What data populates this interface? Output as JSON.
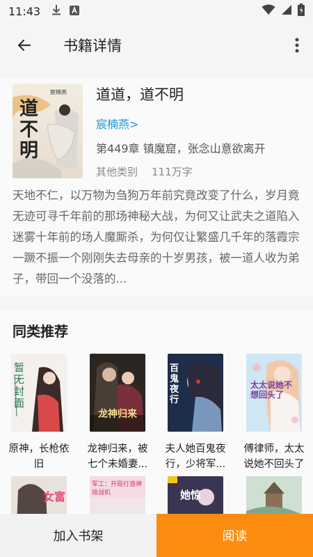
{
  "status_bar": {
    "time": "11:43"
  },
  "app_bar": {
    "title": "书籍详情"
  },
  "book": {
    "title": "道道，道不明",
    "author": "宸楠燕>",
    "latest_chapter": "第449章 镇魔窟，张念山意欲离开",
    "category": "其他类别",
    "word_count": "111万字",
    "description": "天地不仁，以万物为刍狗万年前究竟改变了什么，岁月竟无迹可寻千年前的那场神秘大战，为何又让武夫之道陷入迷雾十年前的场人魔厮杀，为何仅让繁盛几千年的落霞宗一蹶不振一个刚刚失去母亲的十岁男孩，被一道人收为弟子，带回一个没落的...",
    "cover_text": "道不明",
    "cover_author": "宸楠燕"
  },
  "recommend": {
    "title": "同类推荐",
    "items": [
      {
        "name": "原神，长枪依旧",
        "cover_text": "暂无封面"
      },
      {
        "name": "龙神归来，被七个未婚妻...",
        "cover_text": "龙神归来"
      },
      {
        "name": "夫人她百鬼夜行，少将军...",
        "cover_text": "百鬼夜行"
      },
      {
        "name": "傅律师，太太说她不回头了",
        "cover_text": "太太说她不想回头了"
      }
    ],
    "row2_covers": [
      "女富",
      "军工：开局打造神级战机",
      "她惊",
      ""
    ]
  },
  "actions": {
    "add_shelf": "加入书架",
    "read": "阅读"
  },
  "colors": {
    "accent": "#fb8c0f",
    "link": "#1a9bd8"
  }
}
